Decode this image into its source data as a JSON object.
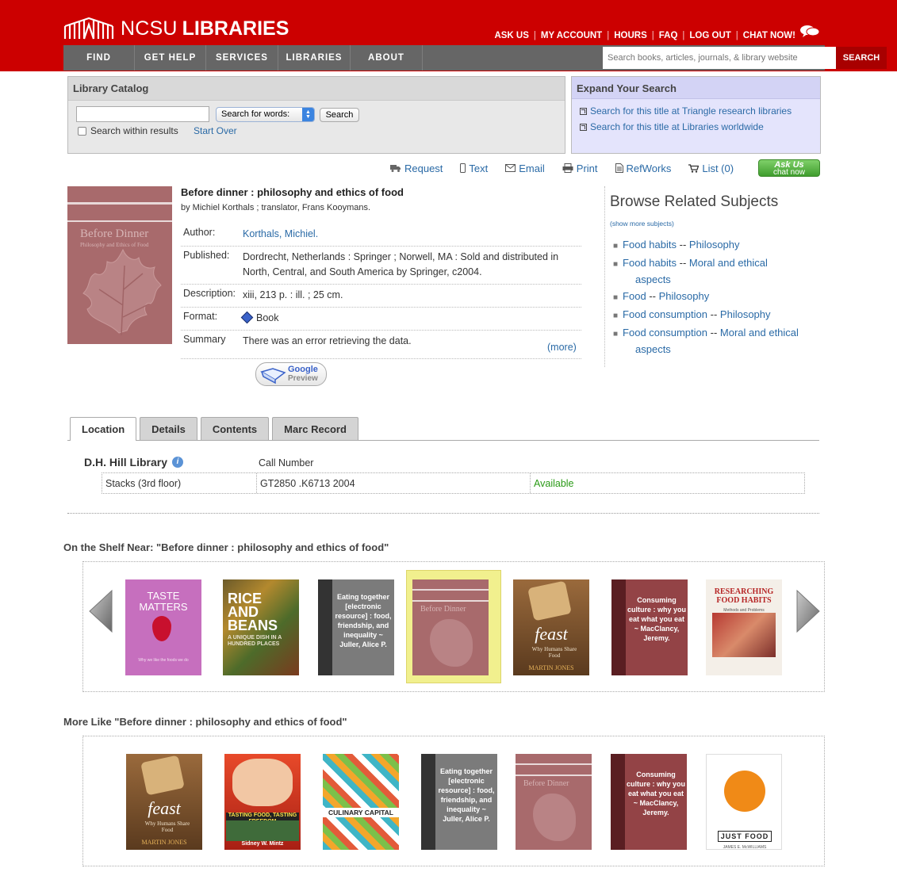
{
  "header": {
    "logo_ncsu": "NCSU",
    "logo_libraries": "LIBRARIES",
    "top_links": [
      "ASK US",
      "MY ACCOUNT",
      "HOURS",
      "FAQ",
      "LOG OUT",
      "CHAT NOW!"
    ],
    "nav": [
      "FIND",
      "GET HELP",
      "SERVICES",
      "LIBRARIES",
      "ABOUT"
    ],
    "search_placeholder": "Search books, articles, journals, & library website",
    "search_button": "SEARCH"
  },
  "catalog": {
    "title": "Library Catalog",
    "input_value": "",
    "select_value": "Search for words:",
    "search_button": "Search",
    "within_label": "Search within results",
    "start_over": "Start Over"
  },
  "expand": {
    "title": "Expand Your Search",
    "links": [
      "Search for this title at Triangle research libraries",
      "Search for this title at Libraries worldwide"
    ]
  },
  "toolbar": {
    "request": "Request",
    "text": "Text",
    "email": "Email",
    "print": "Print",
    "refworks": "RefWorks",
    "list": "List (0)",
    "askus_title": "Ask Us",
    "askus_sub": "chat now"
  },
  "record": {
    "cover_title": "Before Dinner",
    "cover_sub": "Philosophy and Ethics of Food",
    "title": "Before dinner : philosophy and ethics of food",
    "byline": "by Michiel Korthals ; translator, Frans Kooymans.",
    "fields": [
      {
        "label": "Author:",
        "value": "Korthals, Michiel."
      },
      {
        "label": "Published:",
        "value": "Dordrecht, Netherlands : Springer ; Norwell, MA : Sold and distributed in North, Central, and South America by Springer, c2004."
      },
      {
        "label": "Description:",
        "value": "xiii, 213 p. : ill. ; 25 cm."
      },
      {
        "label": "Format:",
        "value": "Book"
      },
      {
        "label": "Summary",
        "value": "There was an error retrieving the data."
      }
    ],
    "more": "(more)",
    "google_label": "Google",
    "preview_label": "Preview"
  },
  "browse": {
    "title": "Browse Related Subjects",
    "show_more": "(show more subjects)",
    "subjects": [
      {
        "a": "Food habits",
        "b": "Philosophy",
        "c": ""
      },
      {
        "a": "Food habits",
        "b": "Moral and ethical",
        "c": "aspects"
      },
      {
        "a": "Food",
        "b": "Philosophy",
        "c": ""
      },
      {
        "a": "Food consumption",
        "b": "Philosophy",
        "c": ""
      },
      {
        "a": "Food consumption",
        "b": "Moral and ethical",
        "c": "aspects"
      }
    ],
    "dash": "--"
  },
  "tabs": [
    "Location",
    "Details",
    "Contents",
    "Marc Record"
  ],
  "location": {
    "library": "D.H. Hill Library",
    "call_number_header": "Call Number",
    "shelf": "Stacks (3rd floor)",
    "call_number": "GT2850 .K6713 2004",
    "status": "Available",
    "status_color": "#2a9a16"
  },
  "shelf_near": {
    "title": "On the Shelf Near: \"Before dinner : philosophy and ethics of food\"",
    "books": [
      {
        "kind": "taste",
        "l1": "TASTE",
        "l2": "MATTERS",
        "sub": "Why we like the foods we do"
      },
      {
        "kind": "rice",
        "l1": "RICE",
        "l2": "AND",
        "l3": "BEANS",
        "sub": "A UNIQUE DISH IN A HUNDRED PLACES"
      },
      {
        "kind": "spine-gray",
        "text": "Eating together [electronic resource] : food, friendship, and inequality ~ Juller, Alice P."
      },
      {
        "kind": "before"
      },
      {
        "kind": "feast",
        "l1": "feast",
        "sub": "Why Humans Share Food",
        "author": "MARTIN JONES"
      },
      {
        "kind": "spine-red",
        "text": "Consuming culture : why you eat what you eat ~ MacClancy, Jeremy."
      },
      {
        "kind": "research",
        "l1": "RESEARCHING",
        "l2": "FOOD HABITS",
        "sub": "Methods and Problems"
      }
    ]
  },
  "more_like": {
    "title": "More Like \"Before dinner : philosophy and ethics of food\"",
    "books": [
      {
        "kind": "feast",
        "l1": "feast",
        "sub": "Why Humans Share Food",
        "author": "MARTIN JONES"
      },
      {
        "kind": "tasting",
        "l1": "TASTING FOOD, TASTING FREEDOM",
        "sub": "Sidney W. Mintz"
      },
      {
        "kind": "culinary",
        "l1": "CULINARY CAPITAL"
      },
      {
        "kind": "spine-gray",
        "text": "Eating together [electronic resource] : food, friendship, and inequality ~ Juller, Alice P."
      },
      {
        "kind": "before"
      },
      {
        "kind": "spine-red",
        "text": "Consuming culture : why you eat what you eat ~ MacClancy, Jeremy."
      },
      {
        "kind": "justfood",
        "l1": "JUST FOOD",
        "sub": "JAMES E. McWILLIAMS"
      }
    ]
  }
}
